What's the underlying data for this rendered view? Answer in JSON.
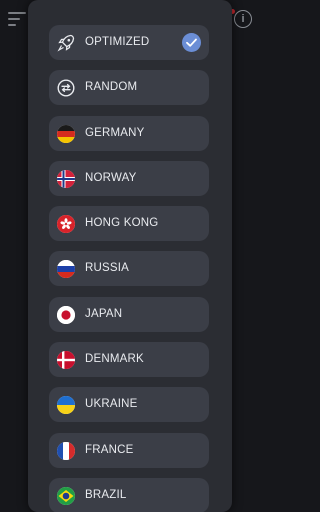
{
  "locations": [
    {
      "label": "OPTIMIZED",
      "icon": "rocket-icon",
      "selected": true
    },
    {
      "label": "RANDOM",
      "icon": "shuffle-icon",
      "selected": false
    },
    {
      "label": "GERMANY",
      "icon": "germany-flag-icon",
      "selected": false
    },
    {
      "label": "NORWAY",
      "icon": "norway-flag-icon",
      "selected": false
    },
    {
      "label": "HONG KONG",
      "icon": "hong-kong-flag-icon",
      "selected": false
    },
    {
      "label": "RUSSIA",
      "icon": "russia-flag-icon",
      "selected": false
    },
    {
      "label": "JAPAN",
      "icon": "japan-flag-icon",
      "selected": false
    },
    {
      "label": "DENMARK",
      "icon": "denmark-flag-icon",
      "selected": false
    },
    {
      "label": "UKRAINE",
      "icon": "ukraine-flag-icon",
      "selected": false
    },
    {
      "label": "FRANCE",
      "icon": "france-flag-icon",
      "selected": false
    },
    {
      "label": "BRAZIL",
      "icon": "brazil-flag-icon",
      "selected": false
    }
  ],
  "colors": {
    "sheet_background": "#2b2d33",
    "item_background": "#3b3e47",
    "selected_check": "#6b8ed6",
    "text": "#e9ebef"
  }
}
